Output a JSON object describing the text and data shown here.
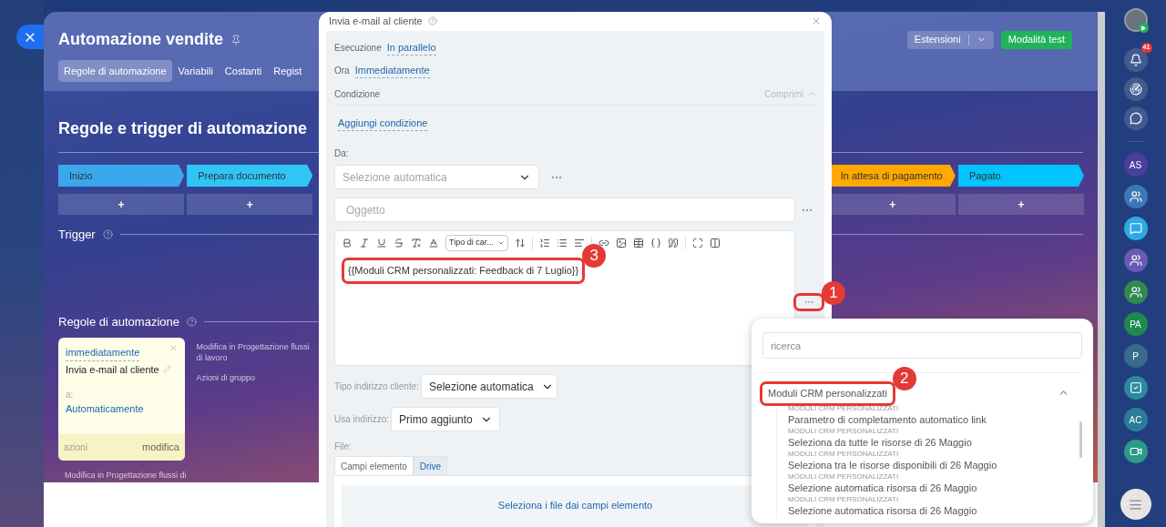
{
  "header": {
    "title": "Automazione vendite",
    "tabs": [
      {
        "label": "Regole di automazione",
        "selected": true
      },
      {
        "label": "Variabili",
        "selected": false
      },
      {
        "label": "Costanti",
        "selected": false
      },
      {
        "label": "Regist",
        "selected": false
      }
    ],
    "extensions": "Estensioni",
    "test_mode": "Modalità test"
  },
  "board": {
    "title": "Regole e trigger di automazione",
    "stages_left": [
      {
        "name": "Inizio",
        "color": "#3ba7ef",
        "add": "+"
      },
      {
        "name": "Prepara documento",
        "color": "#2fc6f6",
        "add": "+"
      }
    ],
    "stages_right": [
      {
        "name": "In attesa di pagamento",
        "color": "#ffa900",
        "add": "+"
      },
      {
        "name": "Pagato",
        "color": "#00c4fb",
        "add": "+"
      }
    ],
    "trigger": "Trigger",
    "rules_title": "Regole di automazione",
    "rule_card": {
      "timing": "immediatamente",
      "title": "Invia e-mail al cliente",
      "to_label": "a:",
      "to_value": "Automaticamente",
      "actions": "azioni",
      "edit": "modifica"
    },
    "side_links": [
      "Modifica in Progettazione flussi di lavoro",
      "Azioni di gruppo"
    ],
    "bottom_link": "Modifica in Progettazione flussi di"
  },
  "dialog": {
    "title": "Invia e-mail al cliente",
    "execution_label": "Esecuzione",
    "execution_value": "In parallelo",
    "time_label": "Ora",
    "time_value": "Immediatamente",
    "condition_label": "Condizione",
    "collapse": "Comprimi",
    "add_condition": "Aggiungi condizione",
    "from_label": "Da:",
    "from_value": "Selezione automatica",
    "subject_placeholder": "Oggetto",
    "font_select": "Tipo di car...",
    "body": {
      "text": "{{Moduli CRM personalizzati: Feedback di 7 Luglio}}",
      "callout": "3"
    },
    "insert_callout": "1",
    "address_type_label": "Tipo indirizzo cliente:",
    "address_type_value": "Selezione automatica",
    "use_address_label": "Usa indirizzo:",
    "use_address_value": "Primo aggiunto",
    "file_label": "File:",
    "file_tabs": [
      {
        "label": "Campi elemento",
        "selected": true
      },
      {
        "label": "Drive",
        "selected": false
      }
    ],
    "file_button": "Seleziona i file dai campi elemento"
  },
  "popup": {
    "search_placeholder": "ricerca",
    "group": {
      "label": "Moduli CRM personalizzati",
      "expanded": true,
      "callout": "2"
    },
    "items": [
      {
        "category": "MODULI CRM PERSONALIZZATI",
        "name": "Parametro di completamento automatico link"
      },
      {
        "category": "MODULI CRM PERSONALIZZATI",
        "name": "Seleziona da tutte le risorse di 26 Maggio"
      },
      {
        "category": "MODULI CRM PERSONALIZZATI",
        "name": "Seleziona tra le risorse disponibili di 26 Maggio"
      },
      {
        "category": "MODULI CRM PERSONALIZZATI",
        "name": "Selezione automatica risorsa di 26 Maggio"
      },
      {
        "category": "MODULI CRM PERSONALIZZATI",
        "name": "Selezione automatica risorsa di 26 Maggio"
      }
    ]
  },
  "sidebar": {
    "notifications": "41",
    "contacts": [
      {
        "kind": "initials",
        "label": "AS",
        "color": "#4b3f9a"
      },
      {
        "kind": "group",
        "color": "#3a78b8"
      },
      {
        "kind": "chat",
        "color": "#2fa8e6"
      },
      {
        "kind": "group",
        "color": "#6a5ab5"
      },
      {
        "kind": "group",
        "color": "#2f8a4f"
      },
      {
        "kind": "initials",
        "label": "PA",
        "color": "#1f8a4e"
      },
      {
        "kind": "initials",
        "label": "P",
        "color": "#3a6b8f"
      },
      {
        "kind": "task",
        "color": "#2a8a9a"
      },
      {
        "kind": "initials",
        "label": "AC",
        "color": "#2a7d9a"
      },
      {
        "kind": "video",
        "color": "#2a9a8a"
      }
    ]
  }
}
